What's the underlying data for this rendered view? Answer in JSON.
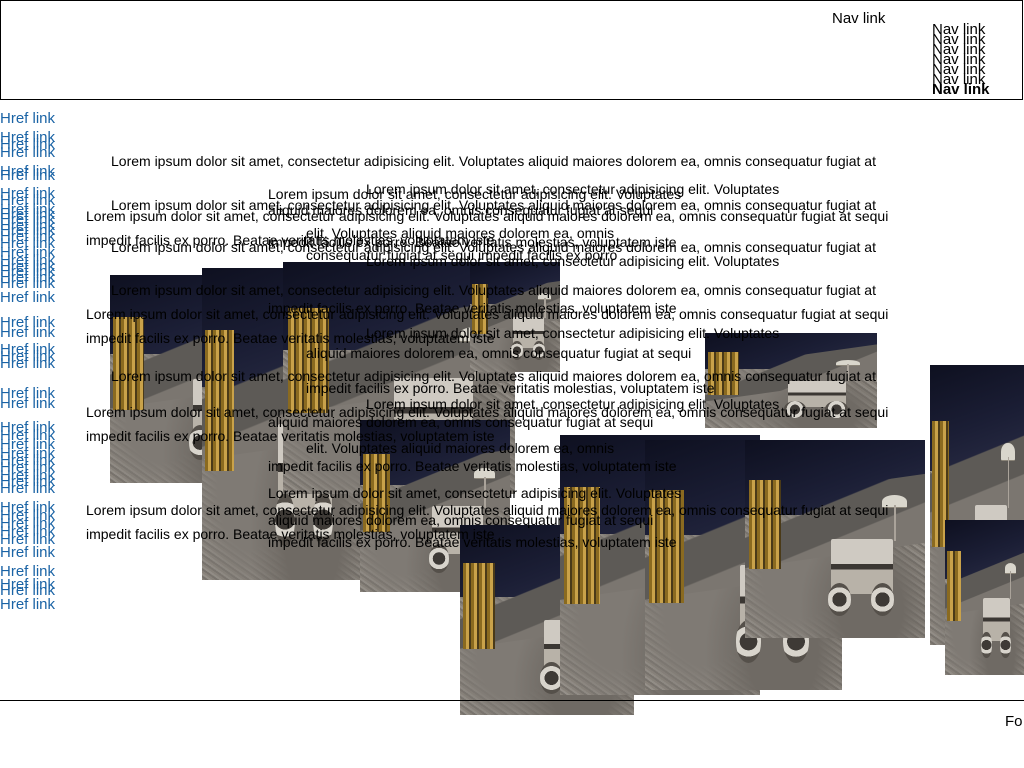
{
  "header": {
    "nav_links": [
      "Nav link",
      "Nav link",
      "Nav link",
      "Nav link",
      "Nav link",
      "Nav link",
      "Nav link",
      "Nav link"
    ]
  },
  "sidebar": {
    "href_links": [
      "Href link",
      "Href link",
      "Href link",
      "Href link",
      "Href link",
      "Href link",
      "Href link",
      "Href link",
      "Href link",
      "Href link",
      "Href link",
      "Href link",
      "Href link",
      "Href link",
      "Href link",
      "Href link",
      "Href link",
      "Href link",
      "Href link",
      "Href link",
      "Href link",
      "Href link",
      "Href link",
      "Href link",
      "Href link",
      "Href link",
      "Href link",
      "Href link",
      "Href link",
      "Href link",
      "Href link",
      "Href link",
      "Href link",
      "Href link",
      "Href link",
      "Href link",
      "Href link",
      "Href link",
      "Href link",
      "Href link",
      "Href link",
      "Href link",
      "Href link",
      "Href link",
      "Href link",
      "Href link",
      "Href link",
      "Href link"
    ]
  },
  "content": {
    "lorem_line_a": "Lorem ipsum dolor sit amet, consectetur adipisicing elit. Voluptates aliquid maiores dolorem ea, omnis consequatur fugiat at",
    "lorem_line_b": "Lorem ipsum dolor sit amet, consectetur adipisicing elit. Voluptates aliquid maiores dolorem ea, omnis consequatur fugiat at sequi",
    "lorem_line_c": "impedit facilis ex porro. Beatae veritatis molestias, voluptatem iste",
    "lorem_short_1": "Lorem ipsum dolor sit amet, consectetur adipisicing elit. Voluptates",
    "lorem_short_2": "aliquid maiores dolorem ea, omnis consequatur fugiat at sequi",
    "lorem_short_3": "impedit facilis ex porro. Beatae veritatis molestias, voluptatem iste",
    "lorem_short_4": "elit. Voluptates aliquid maiores dolorem ea, omnis",
    "lorem_short_5": "consequatur fugiat at sequi impedit facilis ex porro"
  },
  "footer": {
    "text": "Fo"
  }
}
